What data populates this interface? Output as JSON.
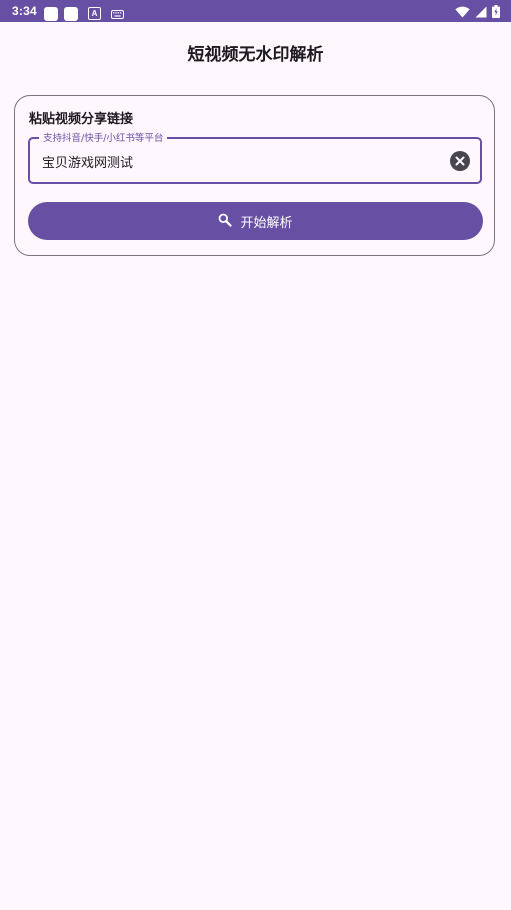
{
  "status_bar": {
    "time": "3:34",
    "notification_icons": [
      "app-icon",
      "app-icon",
      "text-a-icon",
      "keyboard-icon"
    ],
    "system_icons": [
      "wifi-icon",
      "signal-icon",
      "battery-charging-icon"
    ]
  },
  "header": {
    "title": "短视频无水印解析"
  },
  "card": {
    "title": "粘贴视频分享链接",
    "field": {
      "label": "支持抖音/快手/小红书等平台",
      "value": "宝贝游戏网测试",
      "clear_icon": "clear-circle-icon"
    },
    "parse_button": {
      "icon": "search-icon",
      "label": "开始解析"
    }
  },
  "colors": {
    "primary": "#6750a4",
    "background": "#fef7fe",
    "outline": "#79747e",
    "on_surface": "#1d1b20"
  }
}
